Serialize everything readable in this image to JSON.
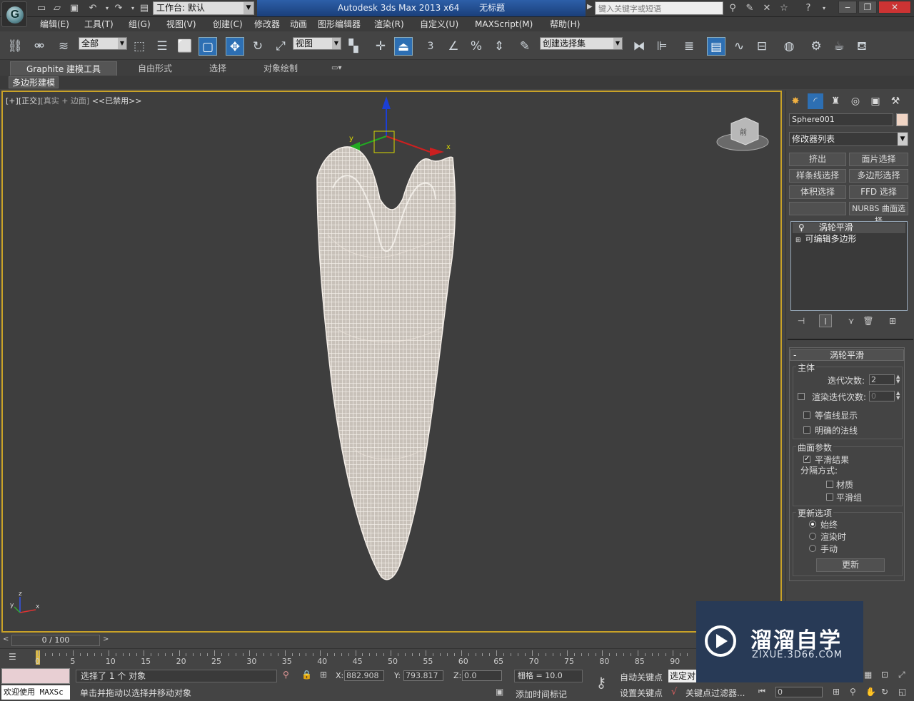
{
  "title": {
    "workspace": "工作台: 默认",
    "app": "Autodesk 3ds Max  2013 x64",
    "document": "无标题",
    "search_placeholder": "键入关键字或短语"
  },
  "menus": [
    "编辑(E)",
    "工具(T)",
    "组(G)",
    "视图(V)",
    "创建(C)",
    "修改器",
    "动画",
    "图形编辑器",
    "渲染(R)",
    "自定义(U)",
    "MAXScript(M)",
    "帮助(H)"
  ],
  "toolbar": {
    "selection_filter": "全部",
    "ref_coord": "视图",
    "named_selection": "创建选择集",
    "snap_3": "3"
  },
  "ribbon": {
    "tabs": [
      "Graphite 建模工具",
      "自由形式",
      "选择",
      "对象绘制"
    ],
    "sub": "多边形建模"
  },
  "viewport": {
    "label_plus": "[+]",
    "label_view": "[正交]",
    "label_shading": "[真实 + 边面]",
    "label_disabled": "<<已禁用>>",
    "gizmo_y": "y",
    "gizmo_x": "x",
    "axis_z": "z",
    "axis_x": "x",
    "axis_y": "y",
    "cube_label": "前"
  },
  "panel": {
    "object_name": "Sphere001",
    "modifier_list": "修改器列表",
    "buttons": [
      "挤出",
      "面片选择",
      "样条线选择",
      "多边形选择",
      "体积选择",
      "FFD 选择",
      "",
      "NURBS 曲面选择"
    ],
    "stack": [
      "涡轮平滑",
      "可编辑多边形"
    ],
    "rollout_title": "涡轮平滑",
    "group_main": "主体",
    "iterations_label": "迭代次数:",
    "iterations_value": "2",
    "render_iter_label": "渲染迭代次数:",
    "render_iter_value": "0",
    "isoline": "等值线显示",
    "explicit_normals": "明确的法线",
    "group_surface": "曲面参数",
    "smooth_result": "平滑结果",
    "separate_by": "分隔方式:",
    "materials": "材质",
    "smoothing_groups": "平滑组",
    "group_update": "更新选项",
    "always": "始终",
    "when_rendering": "渲染时",
    "manually": "手动",
    "update_btn": "更新"
  },
  "timeline": {
    "slider": "0 / 100",
    "ticks": [
      "0",
      "5",
      "10",
      "15",
      "20",
      "25",
      "30",
      "35",
      "40",
      "45",
      "50",
      "55",
      "60",
      "65",
      "70",
      "75",
      "80",
      "85",
      "90"
    ]
  },
  "status": {
    "maxscript": "欢迎使用 MAXSc",
    "selected": "选择了 1 个 对象",
    "prompt": "单击并拖动以选择并移动对象",
    "x_label": "X:",
    "x_value": "882.908",
    "y_label": "Y:",
    "y_value": "793.817",
    "z_label": "Z:",
    "z_value": "0.0",
    "grid": "栅格 = 10.0",
    "add_time_tag": "添加时间标记",
    "auto_key": "自动关键点",
    "set_key": "设置关键点",
    "selected_obj": "选定对",
    "key_filters": "关键点过滤器...",
    "frame": "0"
  },
  "watermark": {
    "name": "溜溜自学",
    "url": "ZIXUE.3D66.COM"
  },
  "colors": {
    "accent": "#2d6fb3",
    "viewport_border": "#c9a227",
    "object_color": "#f0d4c4",
    "mesh_wire": "#f4eee8"
  }
}
